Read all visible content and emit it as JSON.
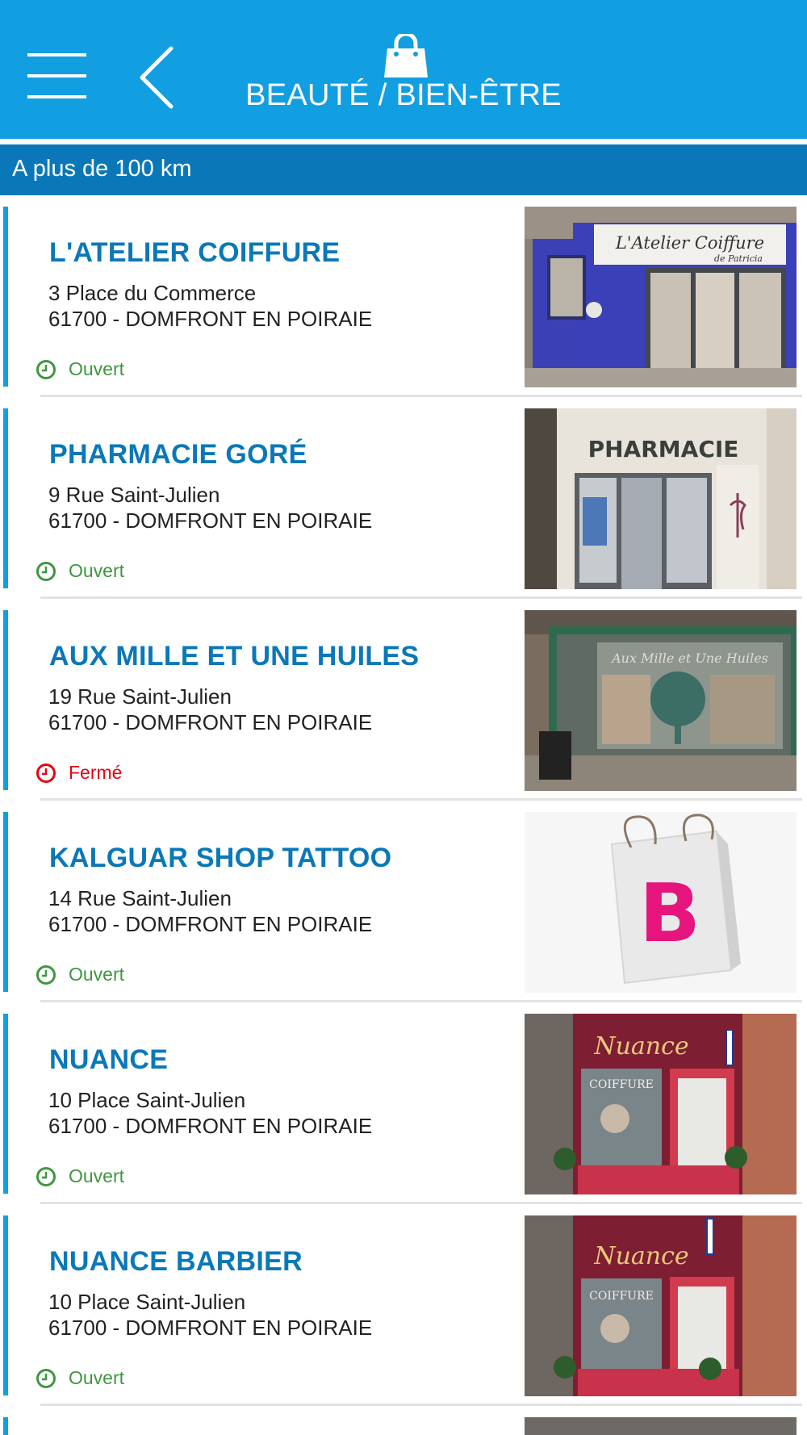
{
  "header": {
    "title": "BEAUTÉ / BIEN-ÊTRE",
    "menu_icon": "hamburger-menu-icon",
    "back_icon": "chevron-left-icon",
    "category_icon": "shopping-bag-icon",
    "background": "#129fe1"
  },
  "distance_bar": {
    "label": "A plus de 100 km",
    "background": "#0a78b8"
  },
  "colors": {
    "accent": "#129fe1",
    "name": "#0a78b8",
    "open": "#3f963f",
    "closed": "#e30613"
  },
  "shops": [
    {
      "name": "L'ATELIER COIFFURE",
      "address": "3 Place du Commerce",
      "city": "61700 - DOMFRONT EN POIRAIE",
      "status": "Ouvert",
      "open": true
    },
    {
      "name": "PHARMACIE GORÉ",
      "address": "9 Rue Saint-Julien",
      "city": "61700 - DOMFRONT EN POIRAIE",
      "status": "Ouvert",
      "open": true
    },
    {
      "name": "AUX MILLE ET UNE HUILES",
      "address": "19 Rue Saint-Julien",
      "city": "61700 - DOMFRONT EN POIRAIE",
      "status": "Fermé",
      "open": false
    },
    {
      "name": "KALGUAR SHOP TATTOO",
      "address": "14 Rue Saint-Julien",
      "city": "61700 - DOMFRONT EN POIRAIE",
      "status": "Ouvert",
      "open": true
    },
    {
      "name": "NUANCE",
      "address": "10 Place Saint-Julien",
      "city": "61700 - DOMFRONT EN POIRAIE",
      "status": "Ouvert",
      "open": true
    },
    {
      "name": "NUANCE BARBIER",
      "address": "10 Place Saint-Julien",
      "city": "61700 - DOMFRONT EN POIRAIE",
      "status": "Ouvert",
      "open": true
    }
  ],
  "photo_signs": {
    "atelier_line1": "L'Atelier Coiffure",
    "atelier_line2": "de Patricia",
    "pharmacie": "PHARMACIE",
    "huiles": "Aux Mille et Une Huiles",
    "placeholder_letter": "B",
    "nuance": "Nuance",
    "coiffure": "COIFFURE"
  }
}
